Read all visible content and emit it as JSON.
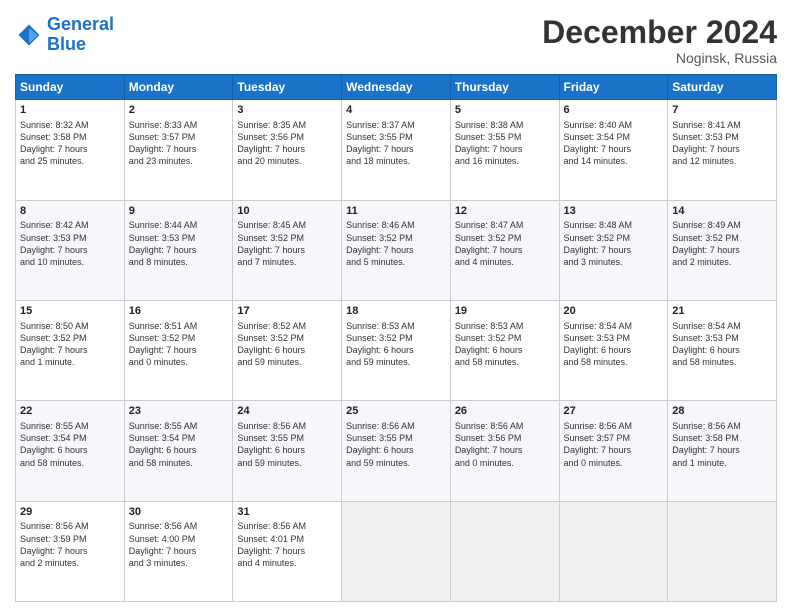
{
  "logo": {
    "line1": "General",
    "line2": "Blue"
  },
  "header": {
    "month": "December 2024",
    "location": "Noginsk, Russia"
  },
  "weekdays": [
    "Sunday",
    "Monday",
    "Tuesday",
    "Wednesday",
    "Thursday",
    "Friday",
    "Saturday"
  ],
  "weeks": [
    [
      {
        "day": "1",
        "info": "Sunrise: 8:32 AM\nSunset: 3:58 PM\nDaylight: 7 hours\nand 25 minutes."
      },
      {
        "day": "2",
        "info": "Sunrise: 8:33 AM\nSunset: 3:57 PM\nDaylight: 7 hours\nand 23 minutes."
      },
      {
        "day": "3",
        "info": "Sunrise: 8:35 AM\nSunset: 3:56 PM\nDaylight: 7 hours\nand 20 minutes."
      },
      {
        "day": "4",
        "info": "Sunrise: 8:37 AM\nSunset: 3:55 PM\nDaylight: 7 hours\nand 18 minutes."
      },
      {
        "day": "5",
        "info": "Sunrise: 8:38 AM\nSunset: 3:55 PM\nDaylight: 7 hours\nand 16 minutes."
      },
      {
        "day": "6",
        "info": "Sunrise: 8:40 AM\nSunset: 3:54 PM\nDaylight: 7 hours\nand 14 minutes."
      },
      {
        "day": "7",
        "info": "Sunrise: 8:41 AM\nSunset: 3:53 PM\nDaylight: 7 hours\nand 12 minutes."
      }
    ],
    [
      {
        "day": "8",
        "info": "Sunrise: 8:42 AM\nSunset: 3:53 PM\nDaylight: 7 hours\nand 10 minutes."
      },
      {
        "day": "9",
        "info": "Sunrise: 8:44 AM\nSunset: 3:53 PM\nDaylight: 7 hours\nand 8 minutes."
      },
      {
        "day": "10",
        "info": "Sunrise: 8:45 AM\nSunset: 3:52 PM\nDaylight: 7 hours\nand 7 minutes."
      },
      {
        "day": "11",
        "info": "Sunrise: 8:46 AM\nSunset: 3:52 PM\nDaylight: 7 hours\nand 5 minutes."
      },
      {
        "day": "12",
        "info": "Sunrise: 8:47 AM\nSunset: 3:52 PM\nDaylight: 7 hours\nand 4 minutes."
      },
      {
        "day": "13",
        "info": "Sunrise: 8:48 AM\nSunset: 3:52 PM\nDaylight: 7 hours\nand 3 minutes."
      },
      {
        "day": "14",
        "info": "Sunrise: 8:49 AM\nSunset: 3:52 PM\nDaylight: 7 hours\nand 2 minutes."
      }
    ],
    [
      {
        "day": "15",
        "info": "Sunrise: 8:50 AM\nSunset: 3:52 PM\nDaylight: 7 hours\nand 1 minute."
      },
      {
        "day": "16",
        "info": "Sunrise: 8:51 AM\nSunset: 3:52 PM\nDaylight: 7 hours\nand 0 minutes."
      },
      {
        "day": "17",
        "info": "Sunrise: 8:52 AM\nSunset: 3:52 PM\nDaylight: 6 hours\nand 59 minutes."
      },
      {
        "day": "18",
        "info": "Sunrise: 8:53 AM\nSunset: 3:52 PM\nDaylight: 6 hours\nand 59 minutes."
      },
      {
        "day": "19",
        "info": "Sunrise: 8:53 AM\nSunset: 3:52 PM\nDaylight: 6 hours\nand 58 minutes."
      },
      {
        "day": "20",
        "info": "Sunrise: 8:54 AM\nSunset: 3:53 PM\nDaylight: 6 hours\nand 58 minutes."
      },
      {
        "day": "21",
        "info": "Sunrise: 8:54 AM\nSunset: 3:53 PM\nDaylight: 6 hours\nand 58 minutes."
      }
    ],
    [
      {
        "day": "22",
        "info": "Sunrise: 8:55 AM\nSunset: 3:54 PM\nDaylight: 6 hours\nand 58 minutes."
      },
      {
        "day": "23",
        "info": "Sunrise: 8:55 AM\nSunset: 3:54 PM\nDaylight: 6 hours\nand 58 minutes."
      },
      {
        "day": "24",
        "info": "Sunrise: 8:56 AM\nSunset: 3:55 PM\nDaylight: 6 hours\nand 59 minutes."
      },
      {
        "day": "25",
        "info": "Sunrise: 8:56 AM\nSunset: 3:55 PM\nDaylight: 6 hours\nand 59 minutes."
      },
      {
        "day": "26",
        "info": "Sunrise: 8:56 AM\nSunset: 3:56 PM\nDaylight: 7 hours\nand 0 minutes."
      },
      {
        "day": "27",
        "info": "Sunrise: 8:56 AM\nSunset: 3:57 PM\nDaylight: 7 hours\nand 0 minutes."
      },
      {
        "day": "28",
        "info": "Sunrise: 8:56 AM\nSunset: 3:58 PM\nDaylight: 7 hours\nand 1 minute."
      }
    ],
    [
      {
        "day": "29",
        "info": "Sunrise: 8:56 AM\nSunset: 3:59 PM\nDaylight: 7 hours\nand 2 minutes."
      },
      {
        "day": "30",
        "info": "Sunrise: 8:56 AM\nSunset: 4:00 PM\nDaylight: 7 hours\nand 3 minutes."
      },
      {
        "day": "31",
        "info": "Sunrise: 8:56 AM\nSunset: 4:01 PM\nDaylight: 7 hours\nand 4 minutes."
      },
      null,
      null,
      null,
      null
    ]
  ]
}
